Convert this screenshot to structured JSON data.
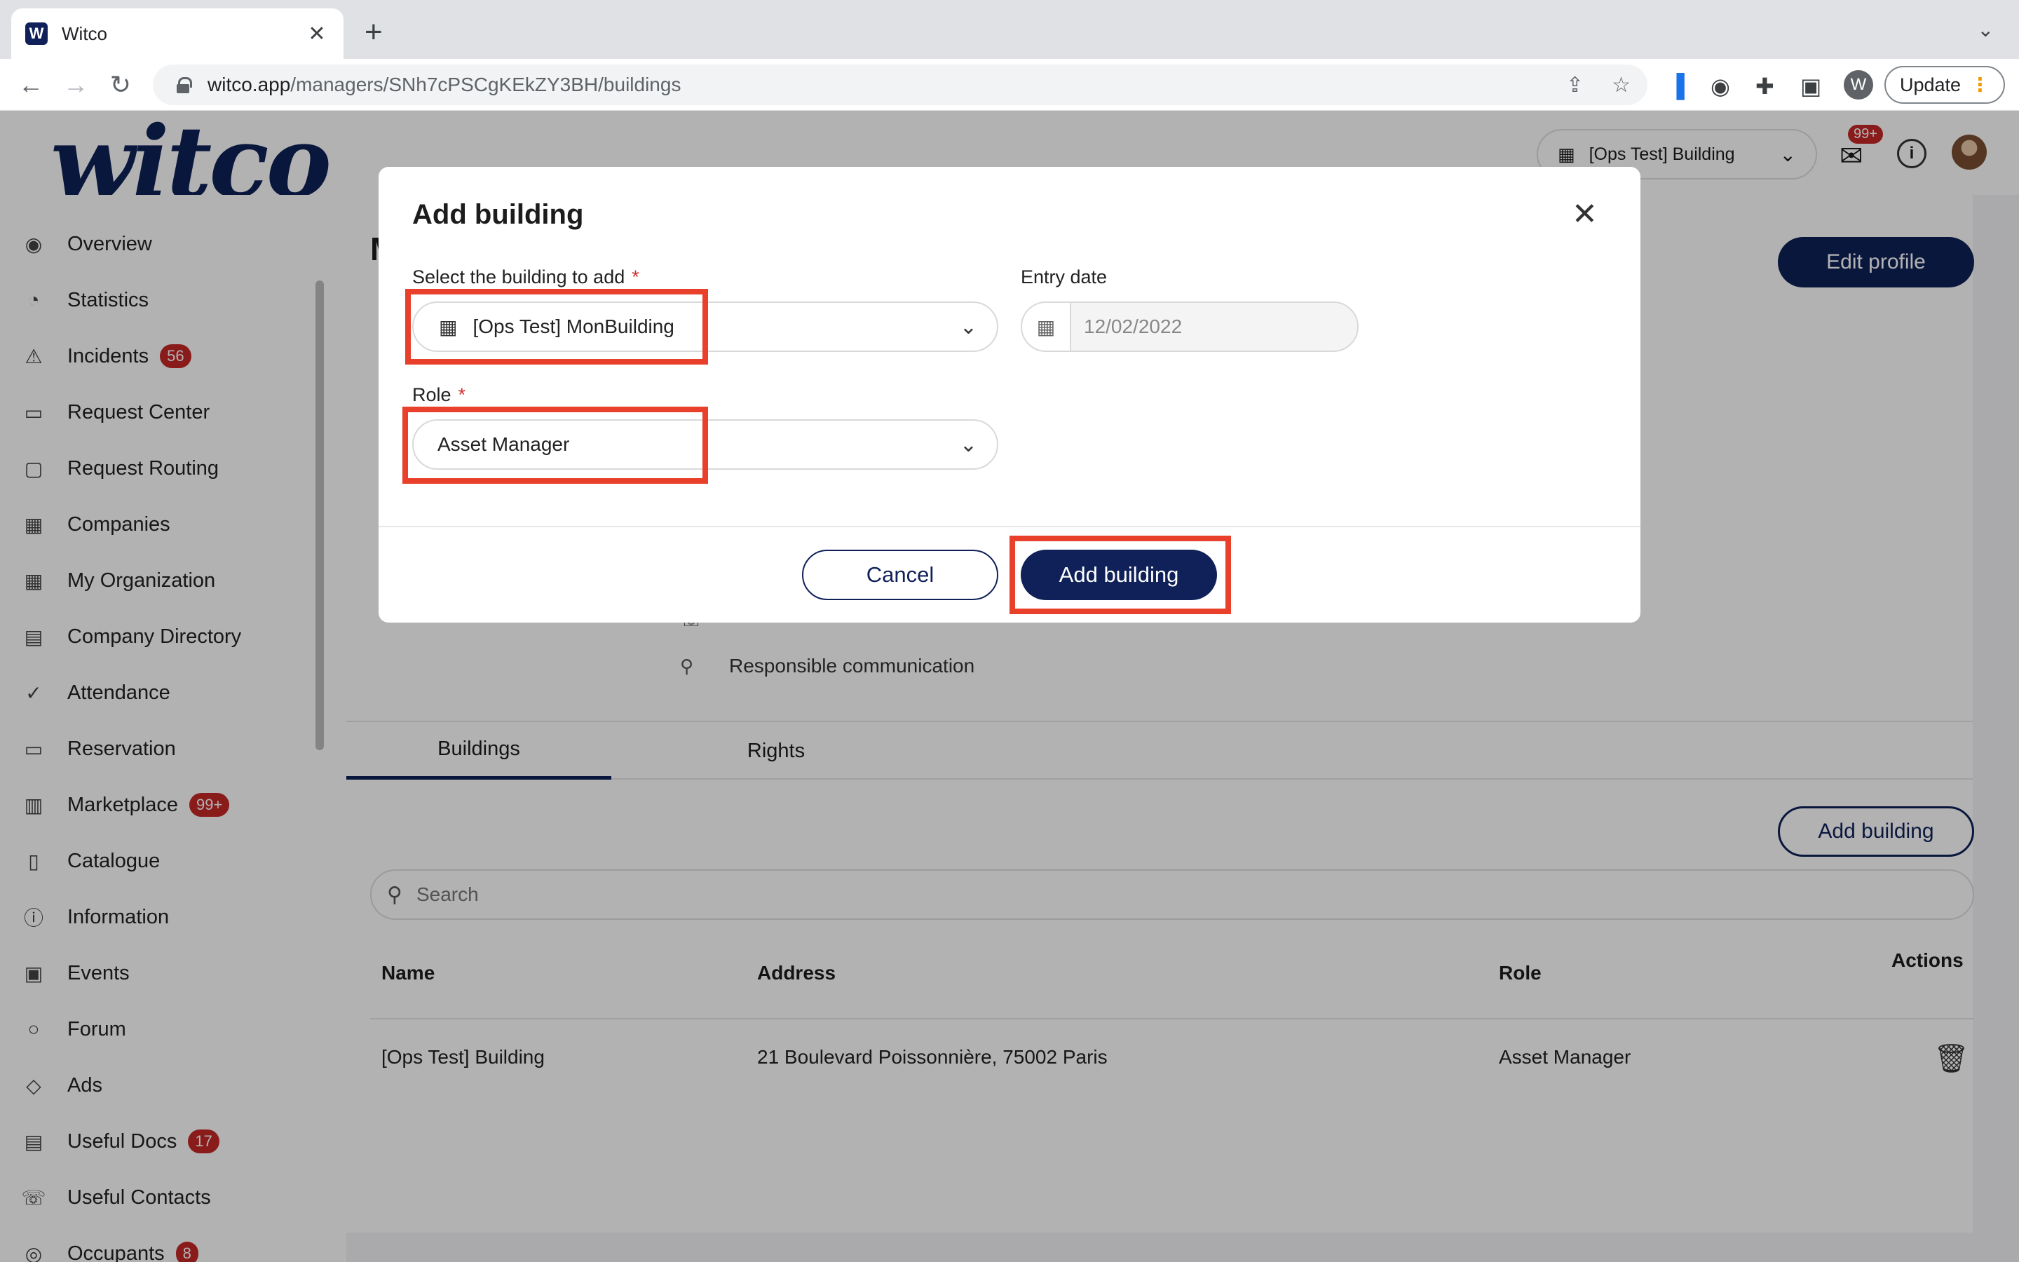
{
  "browser": {
    "tab_title": "Witco",
    "tab_favicon": "W",
    "url_host": "witco.app",
    "url_path": "/managers/SNh7cPSCgKEkZY3BH/buildings",
    "profile_initial": "W",
    "update_label": "Update"
  },
  "header": {
    "logo": "witco",
    "building_select": "[Ops Test] Building",
    "mail_badge": "99+"
  },
  "sidebar": {
    "items": [
      {
        "label": "Overview",
        "icon": "eye-icon"
      },
      {
        "label": "Statistics",
        "icon": "pie-chart-icon"
      },
      {
        "label": "Incidents",
        "icon": "warning-icon",
        "badge": "56"
      },
      {
        "label": "Request Center",
        "icon": "chat-icon"
      },
      {
        "label": "Request Routing",
        "icon": "contact-card-icon"
      },
      {
        "label": "Companies",
        "icon": "building-icon"
      },
      {
        "label": "My Organization",
        "icon": "building-icon"
      },
      {
        "label": "Company Directory",
        "icon": "directory-icon"
      },
      {
        "label": "Attendance",
        "icon": "check-circle-icon"
      },
      {
        "label": "Reservation",
        "icon": "calendar-icon"
      },
      {
        "label": "Marketplace",
        "icon": "store-icon",
        "badge": "99+"
      },
      {
        "label": "Catalogue",
        "icon": "book-icon"
      },
      {
        "label": "Information",
        "icon": "info-icon"
      },
      {
        "label": "Events",
        "icon": "event-icon"
      },
      {
        "label": "Forum",
        "icon": "speech-bubble-icon"
      },
      {
        "label": "Ads",
        "icon": "tag-icon"
      },
      {
        "label": "Useful Docs",
        "icon": "document-icon",
        "badge": "17"
      },
      {
        "label": "Useful Contacts",
        "icon": "phone-icon"
      },
      {
        "label": "Occupants",
        "icon": "people-icon",
        "badge": "8"
      }
    ]
  },
  "main": {
    "title_initial": "M",
    "edit_profile": "Edit profile",
    "phone_value": "-",
    "responsible_label": "Responsible communication",
    "tabs": [
      {
        "label": "Buildings"
      },
      {
        "label": "Rights"
      }
    ],
    "add_building": "Add building",
    "search_placeholder": "Search",
    "table": {
      "headers": {
        "name": "Name",
        "address": "Address",
        "role": "Role",
        "actions": "Actions"
      },
      "rows": [
        {
          "name": "[Ops Test] Building",
          "address": "21 Boulevard Poissonnière, 75002 Paris",
          "role": "Asset Manager"
        }
      ]
    }
  },
  "modal": {
    "title": "Add building",
    "building_label": "Select the building to add",
    "building_value": "[Ops Test] MonBuilding",
    "entry_date_label": "Entry date",
    "entry_date_value": "12/02/2022",
    "role_label": "Role",
    "role_value": "Asset Manager",
    "required_mark": "*",
    "cancel": "Cancel",
    "submit": "Add building"
  },
  "colors": {
    "brand": "#0f2158",
    "badge": "#c62828",
    "highlight": "#e8402a"
  }
}
